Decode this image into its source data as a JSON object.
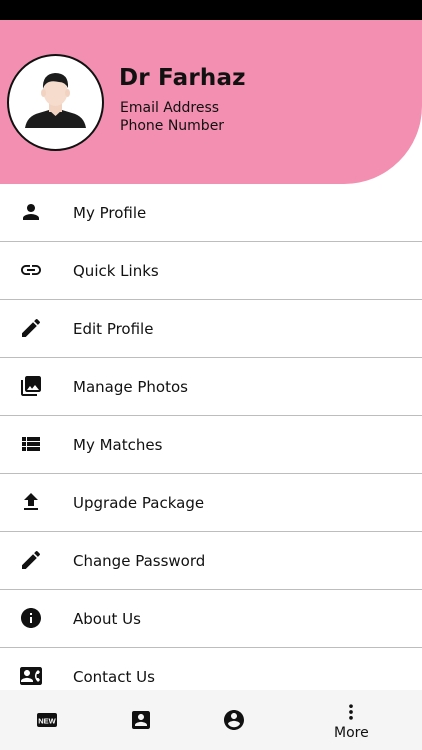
{
  "profile": {
    "name": "Dr Farhaz",
    "email_label": "Email Address",
    "phone_label": "Phone Number",
    "avatar_icon": "user-avatar-icon"
  },
  "menu": [
    {
      "label": "My Profile",
      "icon": "person-icon"
    },
    {
      "label": "Quick Links",
      "icon": "link-icon"
    },
    {
      "label": "Edit Profile",
      "icon": "pencil-icon"
    },
    {
      "label": "Manage Photos",
      "icon": "photo-library-icon"
    },
    {
      "label": "My Matches",
      "icon": "list-icon"
    },
    {
      "label": "Upgrade Package",
      "icon": "upload-icon"
    },
    {
      "label": "Change Password",
      "icon": "pencil-icon"
    },
    {
      "label": "About Us",
      "icon": "info-icon"
    },
    {
      "label": "Contact Us",
      "icon": "contact-card-icon"
    }
  ],
  "bottom_nav": {
    "items": [
      {
        "icon": "new-badge-icon"
      },
      {
        "icon": "contact-box-icon"
      },
      {
        "icon": "account-circle-icon"
      },
      {
        "icon": "more-vertical-icon",
        "label": "More"
      }
    ]
  },
  "colors": {
    "header_bg": "#f38fb1",
    "status_bar": "#000000",
    "divider": "#bdbdbd",
    "bottom_nav_bg": "#f5f5f5"
  }
}
